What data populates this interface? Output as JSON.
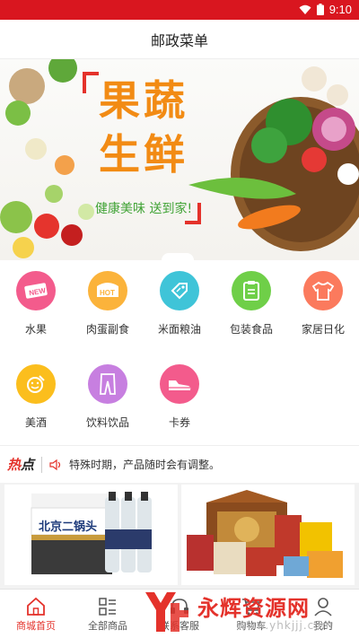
{
  "status_bar": {
    "time": "9:10",
    "wifi_icon": "wifi-icon",
    "battery_icon": "battery-icon"
  },
  "header": {
    "title": "邮政菜单"
  },
  "banner": {
    "title": "果蔬生鲜",
    "slogan": "健康美味 送到家!"
  },
  "categories": [
    {
      "label": "水果",
      "icon": "new-badge-icon",
      "color": "#f35b8c"
    },
    {
      "label": "肉蛋副食",
      "icon": "hot-badge-icon",
      "color": "#fbb33b"
    },
    {
      "label": "米面粮油",
      "icon": "tag-icon",
      "color": "#3fc4d8"
    },
    {
      "label": "包装食品",
      "icon": "clipboard-icon",
      "color": "#6fcf48"
    },
    {
      "label": "家居日化",
      "icon": "tshirt-icon",
      "color": "#fb7a5d"
    },
    {
      "label": "美酒",
      "icon": "smile-note-icon",
      "color": "#fbbe1d"
    },
    {
      "label": "饮料饮品",
      "icon": "pants-icon",
      "color": "#c77fe0"
    },
    {
      "label": "卡券",
      "icon": "shoe-icon",
      "color": "#f35b8c"
    }
  ],
  "notice": {
    "hot_label_1": "热",
    "hot_label_2": "点",
    "text": "特殊时期，产品随时会有调整。"
  },
  "products": [
    {
      "box_label": "北京二锅头"
    },
    {
      "box_label": ""
    }
  ],
  "tabs": [
    {
      "label": "商城首页",
      "active": true
    },
    {
      "label": "全部商品",
      "active": false
    },
    {
      "label": "联系客服",
      "active": false
    },
    {
      "label": "购物车",
      "active": false
    },
    {
      "label": "我的",
      "active": false
    }
  ],
  "watermark": {
    "text": "永辉资源网",
    "url": "www.yhkjjj.com"
  },
  "colors": {
    "brand_red": "#d9161f",
    "accent_red": "#e4322b",
    "slogan_green": "#41a336",
    "title_orange": "#f28b14"
  }
}
